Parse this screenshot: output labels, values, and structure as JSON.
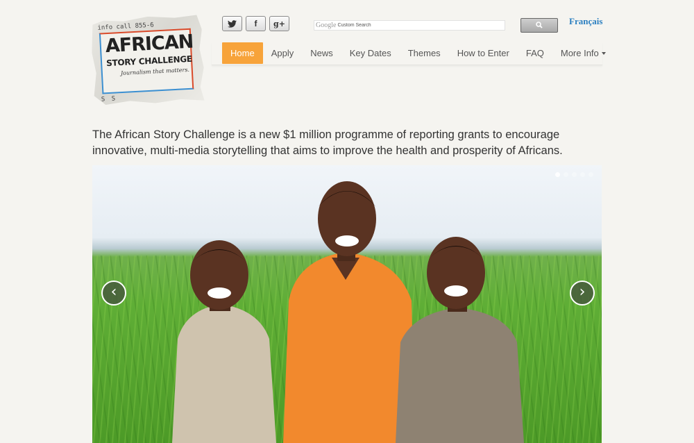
{
  "logo": {
    "top_line": "info call 855-6",
    "line1": "AFRICAN",
    "line2": "STORY CHALLENGE",
    "tagline": "Journalism that matters.",
    "bottom_line": "S S"
  },
  "social": [
    {
      "name": "twitter-icon",
      "glyph": ""
    },
    {
      "name": "facebook-icon",
      "glyph": "f"
    },
    {
      "name": "google-plus-icon",
      "glyph": "g+"
    }
  ],
  "search": {
    "brand": "Google",
    "placeholder": "Custom Search"
  },
  "language_link": "Français",
  "nav": {
    "items": [
      {
        "label": "Home",
        "active": true
      },
      {
        "label": "Apply"
      },
      {
        "label": "News"
      },
      {
        "label": "Key Dates"
      },
      {
        "label": "Themes"
      },
      {
        "label": "How to Enter"
      },
      {
        "label": "FAQ"
      },
      {
        "label": "More Info",
        "dropdown": true
      }
    ]
  },
  "intro": "The African Story Challenge is a new $1 million programme of reporting grants to encourage innovative, multi-media storytelling that aims to improve the health and prosperity of Africans.",
  "slider": {
    "prev_label": "‹",
    "next_label": "›",
    "slide_count": 5,
    "current_slide": 1
  }
}
